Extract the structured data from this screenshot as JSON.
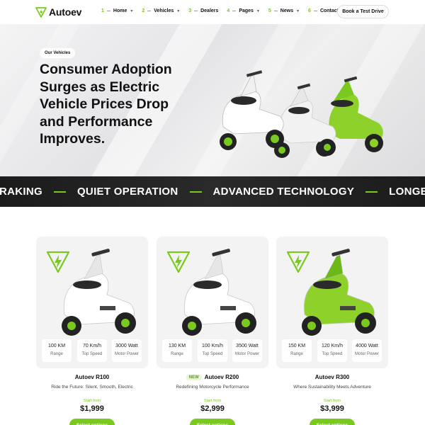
{
  "header": {
    "logo_text": "Autoev",
    "nav": [
      {
        "num": "1",
        "label": "Home",
        "dropdown": true
      },
      {
        "num": "2",
        "label": "Vehicles",
        "dropdown": true
      },
      {
        "num": "3",
        "label": "Dealers",
        "dropdown": false
      },
      {
        "num": "4",
        "label": "Pages",
        "dropdown": true
      },
      {
        "num": "5",
        "label": "News",
        "dropdown": true
      },
      {
        "num": "6",
        "label": "Contact",
        "dropdown": false
      }
    ],
    "cta_label": "Book a Test Drive"
  },
  "hero": {
    "badge": "Our Vehicles",
    "title": "Consumer Adoption Surges as Electric Vehicle Prices Drop and Performance Improves."
  },
  "ticker": {
    "items": [
      "RAKING",
      "QUIET OPERATION",
      "ADVANCED TECHNOLOGY",
      "LONGER R"
    ]
  },
  "products": [
    {
      "name": "Autoev R100",
      "is_new": false,
      "tagline": "Ride the Future: Silent, Smooth, Electric",
      "start_label": "Start from",
      "price": "$1,999",
      "button": "Select options",
      "color": "#ffffff",
      "specs": [
        {
          "value": "100 KM",
          "label": "Range"
        },
        {
          "value": "70 Km/h",
          "label": "Top Speed"
        },
        {
          "value": "3000 Watt",
          "label": "Motor Power"
        }
      ]
    },
    {
      "name": "Autoev R200",
      "is_new": true,
      "new_label": "NEW",
      "tagline": "Redefining Motorcycle Performance",
      "start_label": "Start from",
      "price": "$2,999",
      "button": "Select options",
      "color": "#ffffff",
      "specs": [
        {
          "value": "130 KM",
          "label": "Range"
        },
        {
          "value": "100 Km/h",
          "label": "Top Speed"
        },
        {
          "value": "3500 Watt",
          "label": "Motor Power"
        }
      ]
    },
    {
      "name": "Autoev R300",
      "is_new": false,
      "tagline": "Where Sustainability Meets Adventure",
      "start_label": "Start from",
      "price": "$3,999",
      "button": "Select options",
      "color": "#8ed12a",
      "specs": [
        {
          "value": "150 KM",
          "label": "Range"
        },
        {
          "value": "120 Km/h",
          "label": "Top Speed"
        },
        {
          "value": "4000 Watt",
          "label": "Motor Power"
        }
      ]
    }
  ],
  "colors": {
    "accent": "#7ac91f",
    "ticker_bg": "#1f1f1f"
  }
}
